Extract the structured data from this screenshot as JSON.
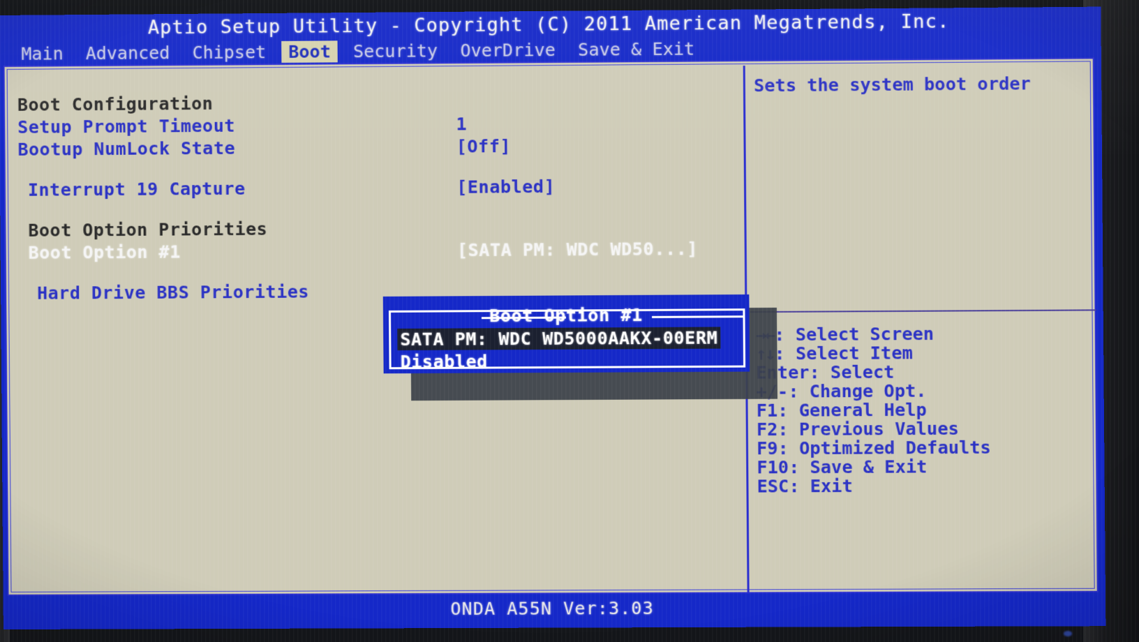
{
  "header": {
    "title": "Aptio Setup Utility - Copyright (C) 2011 American Megatrends, Inc.",
    "tabs": [
      {
        "label": "Main",
        "active": false
      },
      {
        "label": "Advanced",
        "active": false
      },
      {
        "label": "Chipset",
        "active": false
      },
      {
        "label": "Boot",
        "active": true
      },
      {
        "label": "Security",
        "active": false
      },
      {
        "label": "OverDrive",
        "active": false
      },
      {
        "label": "Save & Exit",
        "active": false
      }
    ]
  },
  "settings": {
    "rows": [
      {
        "label": "Boot Configuration",
        "value": "",
        "style": "heading"
      },
      {
        "label": "Setup Prompt Timeout",
        "value": "1",
        "style": "item"
      },
      {
        "label": "Bootup NumLock State",
        "value": "[Off]",
        "style": "item"
      },
      {
        "label": "Interrupt 19 Capture",
        "value": "[Enabled]",
        "style": "item"
      },
      {
        "label": "Boot Option Priorities",
        "value": "",
        "style": "heading"
      },
      {
        "label": "Boot Option #1",
        "value": "[SATA  PM: WDC WD50...]",
        "style": "selected"
      },
      {
        "label": "Hard Drive BBS Priorities",
        "value": "",
        "style": "item"
      }
    ]
  },
  "help": {
    "text": "Sets the system boot order",
    "keys": [
      {
        "key": "→←",
        "label": ": Select Screen"
      },
      {
        "key": "↑↓",
        "label": ": Select Item"
      },
      {
        "key": "Enter",
        "label": ": Select"
      },
      {
        "key": "+/-",
        "label": ": Change Opt."
      },
      {
        "key": "F1",
        "label": ": General Help"
      },
      {
        "key": "F2",
        "label": ": Previous Values"
      },
      {
        "key": "F9",
        "label": ": Optimized Defaults"
      },
      {
        "key": "F10",
        "label": ": Save & Exit"
      },
      {
        "key": "ESC",
        "label": ": Exit"
      }
    ]
  },
  "popup": {
    "title": "Boot Option #1",
    "options": [
      {
        "label": "SATA  PM: WDC WD5000AAKX-00ERM",
        "highlighted": true
      },
      {
        "label": "Disabled",
        "highlighted": false
      }
    ]
  },
  "footer": {
    "text": "ONDA A55N Ver:3.03"
  },
  "colors": {
    "screen_blue": "#1528c8",
    "panel_bg": "#cfccb8",
    "item_blue": "#2a31c4",
    "heading_dark": "#2a2a2a",
    "selected_white": "#f5f5f5",
    "tab_active_bg": "#d6d2ae",
    "popup_highlight_bg": "#1b2030"
  }
}
